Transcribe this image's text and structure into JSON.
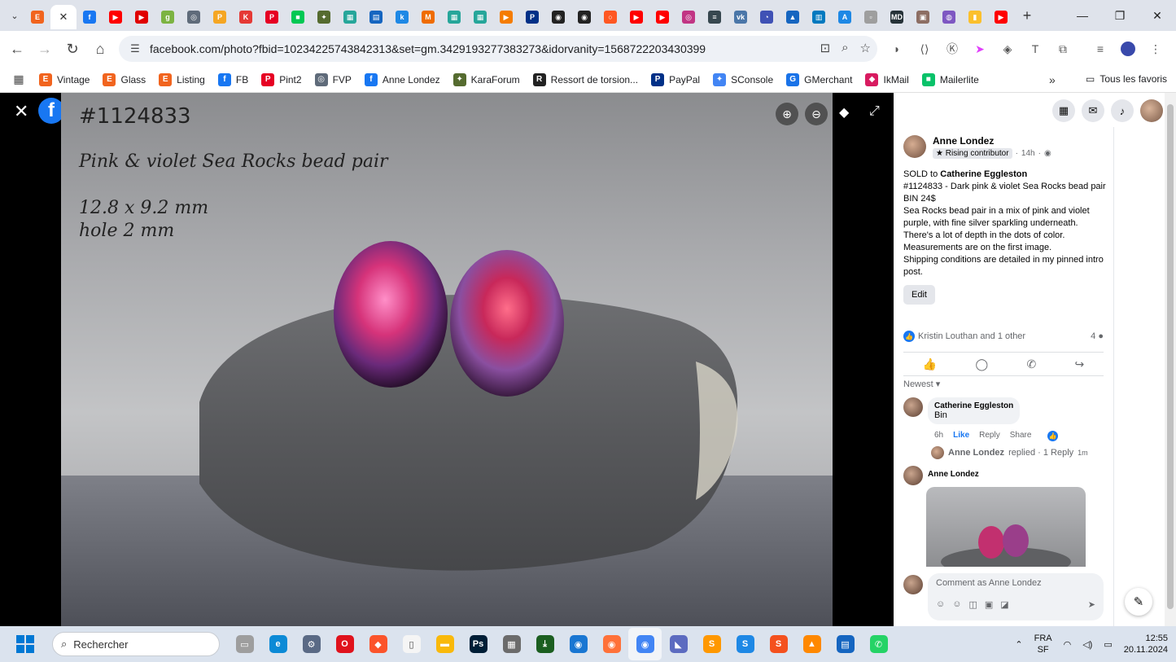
{
  "tabs": [
    {
      "icon": "etsy-icon",
      "label": "E",
      "color": "#f1641e"
    },
    {
      "icon": "close-tab-icon",
      "label": "✕",
      "color": "#333333",
      "active": true
    },
    {
      "icon": "facebook-icon",
      "label": "f",
      "color": "#1877f2"
    },
    {
      "icon": "youtube-icon",
      "label": "▶",
      "color": "#ff0000"
    },
    {
      "icon": "youtube-icon",
      "label": "▶",
      "color": "#e00000"
    },
    {
      "icon": "globe-icon",
      "label": "g",
      "color": "#7cb342"
    },
    {
      "icon": "globe-icon",
      "label": "◎",
      "color": "#5f6b7a"
    },
    {
      "icon": "pp-icon",
      "label": "P",
      "color": "#f5a623"
    },
    {
      "icon": "k-icon",
      "label": "K",
      "color": "#e53935"
    },
    {
      "icon": "pinterest-icon",
      "label": "P",
      "color": "#e60023"
    },
    {
      "icon": "chat-icon",
      "label": "■",
      "color": "#00c853"
    },
    {
      "icon": "bird-icon",
      "label": "✦",
      "color": "#556b2f"
    },
    {
      "icon": "grid-icon",
      "label": "▦",
      "color": "#26a69a"
    },
    {
      "icon": "print-icon",
      "label": "▤",
      "color": "#1565c0"
    },
    {
      "icon": "k-icon",
      "label": "k",
      "color": "#1e88e5"
    },
    {
      "icon": "magento-icon",
      "label": "M",
      "color": "#ef6c00"
    },
    {
      "icon": "grid-icon",
      "label": "▦",
      "color": "#26a69a"
    },
    {
      "icon": "grid-icon",
      "label": "▦",
      "color": "#26a69a"
    },
    {
      "icon": "play-icon",
      "label": "▶",
      "color": "#f57c00"
    },
    {
      "icon": "paypal-icon",
      "label": "P",
      "color": "#003087"
    },
    {
      "icon": "camera-icon",
      "label": "◉",
      "color": "#222222"
    },
    {
      "icon": "camera-icon",
      "label": "◉",
      "color": "#222222"
    },
    {
      "icon": "circle-icon",
      "label": "○",
      "color": "#ff5722"
    },
    {
      "icon": "youtube-icon",
      "label": "▶",
      "color": "#ff0000"
    },
    {
      "icon": "youtube-icon",
      "label": "▶",
      "color": "#ff0000"
    },
    {
      "icon": "instagram-icon",
      "label": "◎",
      "color": "#c13584"
    },
    {
      "icon": "drop-icon",
      "label": "≡",
      "color": "#37474f"
    },
    {
      "icon": "vk-icon",
      "label": "vk",
      "color": "#4a76a8"
    },
    {
      "icon": "compass-icon",
      "label": "◔",
      "color": "#3f51b5"
    },
    {
      "icon": "flag-icon",
      "label": "▲",
      "color": "#1565c0"
    },
    {
      "icon": "trello-icon",
      "label": "▥",
      "color": "#0079bf"
    },
    {
      "icon": "a-icon",
      "label": "A",
      "color": "#1e88e5"
    },
    {
      "icon": "page-icon",
      "label": "▫",
      "color": "#9e9e9e"
    },
    {
      "icon": "md-icon",
      "label": "MD",
      "color": "#263238"
    },
    {
      "icon": "bag-icon",
      "label": "▣",
      "color": "#8d6e63"
    },
    {
      "icon": "ring-icon",
      "label": "◍",
      "color": "#7e57c2"
    },
    {
      "icon": "jar-icon",
      "label": "▮",
      "color": "#fbc02d"
    },
    {
      "icon": "youtube-icon",
      "label": "▶",
      "color": "#ff0000"
    }
  ],
  "browser": {
    "url": "facebook.com/photo?fbid=10234225743842313&set=gm.3429193277383273&idorvanity=1568722203430399",
    "new_tab": "+",
    "minimize": "—",
    "restore": "❐",
    "close": "✕"
  },
  "bookmarks": [
    {
      "label": "Vintage",
      "icon": "etsy-icon",
      "glyph": "E",
      "color": "#f1641e"
    },
    {
      "label": "Glass",
      "icon": "etsy-icon",
      "glyph": "E",
      "color": "#f1641e"
    },
    {
      "label": "Listing",
      "icon": "etsy-icon",
      "glyph": "E",
      "color": "#f1641e"
    },
    {
      "label": "FB",
      "icon": "facebook-icon",
      "glyph": "f",
      "color": "#1877f2"
    },
    {
      "label": "Pint2",
      "icon": "pinterest-icon",
      "glyph": "P",
      "color": "#e60023"
    },
    {
      "label": "FVP",
      "icon": "globe-icon",
      "glyph": "◎",
      "color": "#5f6b7a"
    },
    {
      "label": "Anne Londez",
      "icon": "facebook-icon",
      "glyph": "f",
      "color": "#1877f2"
    },
    {
      "label": "KaraForum",
      "icon": "bird-icon",
      "glyph": "✦",
      "color": "#556b2f"
    },
    {
      "label": "Ressort de torsion...",
      "icon": "ressort-icon",
      "glyph": "R",
      "color": "#222222"
    },
    {
      "label": "PayPal",
      "icon": "paypal-icon",
      "glyph": "P",
      "color": "#003087"
    },
    {
      "label": "SConsole",
      "icon": "sconsole-icon",
      "glyph": "✦",
      "color": "#4285f4"
    },
    {
      "label": "GMerchant",
      "icon": "merchant-icon",
      "glyph": "G",
      "color": "#1a73e8"
    },
    {
      "label": "IkMail",
      "icon": "mail-icon",
      "glyph": "◆",
      "color": "#d81b60"
    },
    {
      "label": "Mailerlite",
      "icon": "chat-icon",
      "glyph": "■",
      "color": "#09c269"
    }
  ],
  "bookmarks_overflow": "»",
  "all_bookmarks": "Tous les favoris",
  "photo": {
    "line1": "#1124833",
    "line2": "Pink & violet Sea Rocks bead pair",
    "line3": "12.8 x 9.2 mm",
    "line4": "hole 2 mm"
  },
  "post": {
    "author": "Anne Londez",
    "badge": "Rising contributor",
    "time": "14h",
    "text_prefix": "SOLD to ",
    "sold_to": "Catherine Eggleston",
    "body": [
      "#1124833 - Dark pink & violet Sea Rocks bead pair",
      "BIN 24$",
      "Sea Rocks bead pair in a mix of pink and violet purple, with fine silver sparkling underneath. There's a lot of depth in the dots of color.",
      "Measurements are on the first image.",
      "Shipping conditions are detailed in my pinned intro post."
    ],
    "edit": "Edit",
    "reactions_text": "Kristin Louthan and 1 other",
    "comment_count": "4",
    "sort": "Newest"
  },
  "comment1": {
    "author": "Catherine Eggleston",
    "text": "Bin",
    "time": "6h",
    "like": "Like",
    "reply": "Reply",
    "share": "Share"
  },
  "reply_summary": {
    "who": "Anne Londez",
    "text": "replied · 1 Reply",
    "time": "1m"
  },
  "comment2": {
    "author": "Anne Londez"
  },
  "comment_box": {
    "placeholder": "Comment as Anne Londez"
  },
  "taskbar": {
    "search": "Rechercher",
    "lang1": "FRA",
    "lang2": "SF",
    "time": "12:55",
    "date": "20.11.2024",
    "apps": [
      {
        "icon": "file-explorer-icon",
        "glyph": "▭",
        "color": "#9e9e9e"
      },
      {
        "icon": "edge-icon",
        "glyph": "e",
        "color": "#0c8ad6"
      },
      {
        "icon": "settings-icon",
        "glyph": "⚙",
        "color": "#5a6a85"
      },
      {
        "icon": "opera-icon",
        "glyph": "O",
        "color": "#e0121c"
      },
      {
        "icon": "brave-icon",
        "glyph": "◆",
        "color": "#fb542b"
      },
      {
        "icon": "notepad-icon",
        "glyph": "▯",
        "color": "#f5f5f5"
      },
      {
        "icon": "folder-icon",
        "glyph": "▬",
        "color": "#f9b90b"
      },
      {
        "icon": "photoshop-icon",
        "glyph": "Ps",
        "color": "#001e36"
      },
      {
        "icon": "calculator-icon",
        "glyph": "▦",
        "color": "#6b6b6b"
      },
      {
        "icon": "download-icon",
        "glyph": "⤓",
        "color": "#1b5e20"
      },
      {
        "icon": "photos-icon",
        "glyph": "◉",
        "color": "#1976d2"
      },
      {
        "icon": "firefox-icon",
        "glyph": "◉",
        "color": "#ff7139"
      },
      {
        "icon": "chrome-icon",
        "glyph": "◉",
        "color": "#4285f4"
      },
      {
        "icon": "edge-alt-icon",
        "glyph": "◣",
        "color": "#5c6bc0"
      },
      {
        "icon": "sublime-icon",
        "glyph": "S",
        "color": "#ff9800"
      },
      {
        "icon": "s-app-icon",
        "glyph": "S",
        "color": "#1e88e5"
      },
      {
        "icon": "s-app-icon",
        "glyph": "S",
        "color": "#f4511e"
      },
      {
        "icon": "vlc-icon",
        "glyph": "▲",
        "color": "#ff8800"
      },
      {
        "icon": "document-icon",
        "glyph": "▤",
        "color": "#1565c0"
      },
      {
        "icon": "whatsapp-icon",
        "glyph": "✆",
        "color": "#25d366"
      }
    ]
  }
}
